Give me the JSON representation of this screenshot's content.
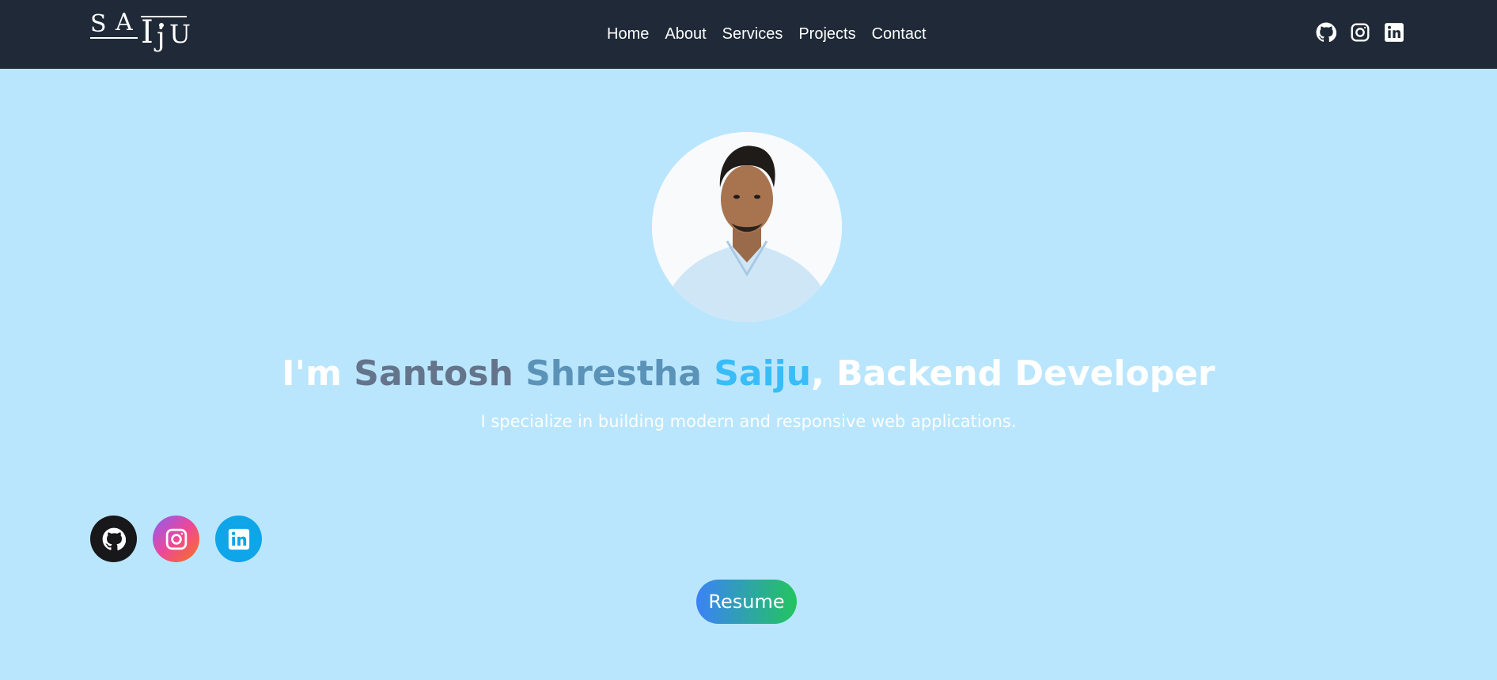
{
  "nav": {
    "logo_text": "SAIJU",
    "links": [
      "Home",
      "About",
      "Services",
      "Projects",
      "Contact"
    ],
    "social": [
      "github-icon",
      "instagram-icon",
      "linkedin-icon"
    ]
  },
  "hero": {
    "headline_prefix": "I'm ",
    "name_part1": "Santosh",
    "name_part2": "Shrestha",
    "name_part3": "Saiju",
    "headline_suffix": ", Backend Developer",
    "subtitle": "I specialize in building modern and responsive web applications.",
    "resume_label": "Resume",
    "social": [
      "github-icon",
      "instagram-icon",
      "linkedin-icon"
    ]
  },
  "colors": {
    "page_bg": "#bae6fd",
    "nav_bg": "#1f2937",
    "github": "#18181b",
    "linkedin": "#0ea5e9"
  }
}
